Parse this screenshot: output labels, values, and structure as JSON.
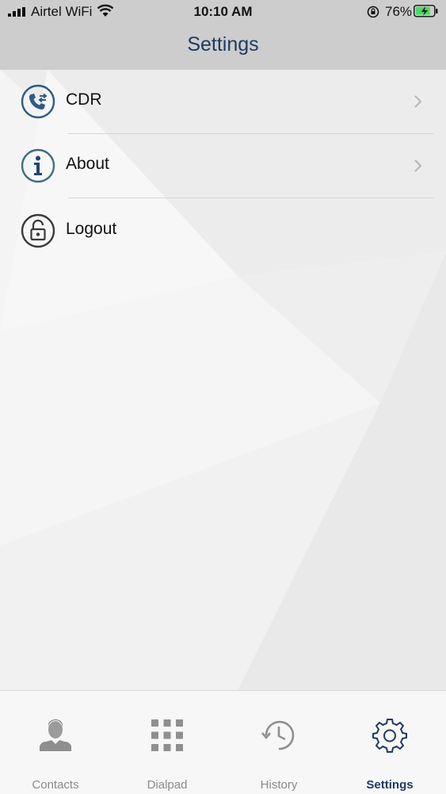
{
  "status_bar": {
    "carrier": "Airtel WiFi",
    "time": "10:10 AM",
    "battery": "76%"
  },
  "header": {
    "title": "Settings"
  },
  "menu": [
    {
      "label": "CDR",
      "icon": "phone-log-icon",
      "has_chevron": true
    },
    {
      "label": "About",
      "icon": "info-icon",
      "has_chevron": true
    },
    {
      "label": "Logout",
      "icon": "lock-icon",
      "has_chevron": false
    }
  ],
  "tabs": [
    {
      "label": "Contacts",
      "icon": "contacts-icon",
      "active": false
    },
    {
      "label": "Dialpad",
      "icon": "dialpad-icon",
      "active": false
    },
    {
      "label": "History",
      "icon": "history-icon",
      "active": false
    },
    {
      "label": "Settings",
      "icon": "gear-icon",
      "active": true
    }
  ],
  "colors": {
    "accent": "#1f3a63",
    "header_bg": "#cdcdcd",
    "inactive_tab": "#8a8a8a"
  }
}
